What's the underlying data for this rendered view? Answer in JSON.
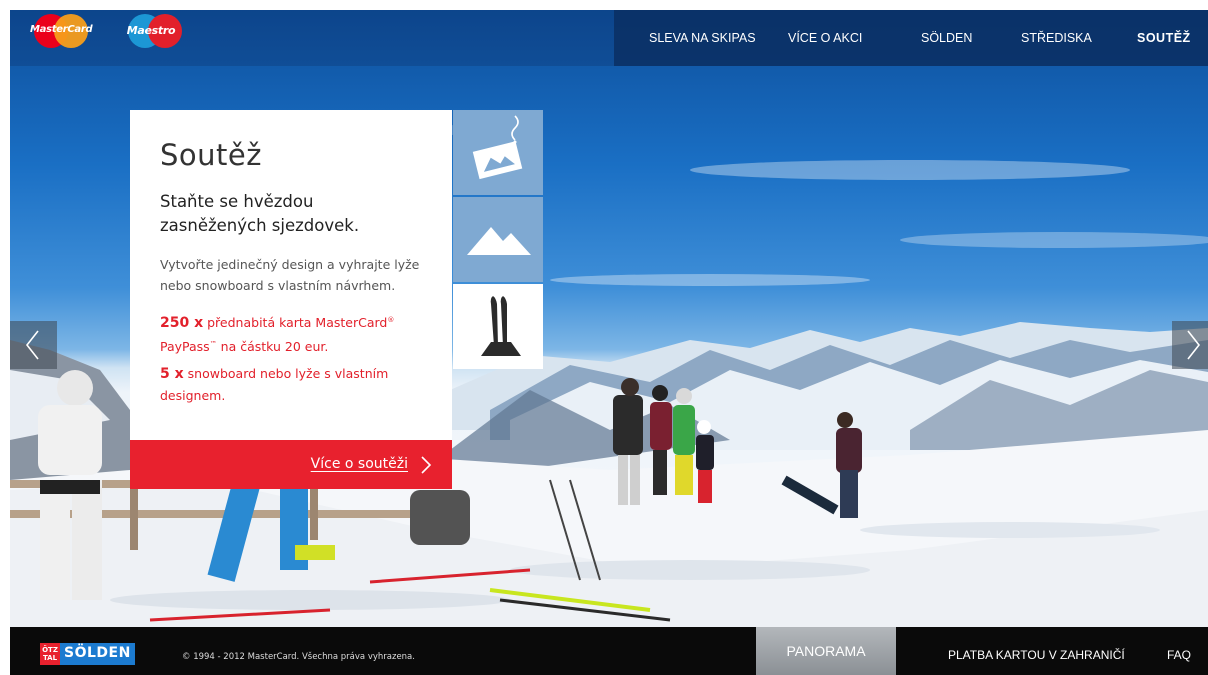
{
  "header": {
    "brand_logos": [
      {
        "name": "MasterCard",
        "text": "MasterCard",
        "colors": [
          "#eb001b",
          "#f79e1b"
        ]
      },
      {
        "name": "Maestro",
        "text": "Maestro",
        "colors": [
          "#1c97d5",
          "#e2202b"
        ]
      }
    ],
    "nav": [
      {
        "label": "SLEVA NA SKIPAS",
        "active": false
      },
      {
        "label": "VÍCE O AKCI",
        "active": false
      },
      {
        "label": "SÖLDEN",
        "active": false
      },
      {
        "label": "STŘEDISKA",
        "active": false
      },
      {
        "label": "SOUTĚŽ",
        "active": true
      }
    ]
  },
  "card": {
    "title": "Soutěž",
    "subtitle": "Staňte se hvězdou zasněžených sjezdovek.",
    "body": "Vytvořte jedinečný design a vyhrajte lyže nebo snowboard s vlastním návrhem.",
    "prize1_count": "250 x",
    "prize1_text_a": "přednabitá karta MasterCard",
    "prize1_sup": "®",
    "prize1_text_b": "PayPass",
    "prize1_tm": "™",
    "prize1_text_c": " na částku 20 eur.",
    "prize2_count": "5 x",
    "prize2_text": "snowboard nebo lyže s vlastním designem.",
    "cta_label": "Více o soutěži"
  },
  "tiles": [
    {
      "icon": "snow-postcard-icon"
    },
    {
      "icon": "mountain-icon"
    },
    {
      "icon": "skis-icon"
    }
  ],
  "footer": {
    "logo_tag": "ÖTZ TAL",
    "logo_word": "SÖLDEN",
    "copyright": "© 1994 - 2012 MasterCard. Všechna práva vyhrazena.",
    "panorama": "PANORAMA",
    "payment_link": "PLATBA KARTOU V ZAHRANIČÍ",
    "faq": "FAQ"
  },
  "colors": {
    "accent_red": "#e8212e",
    "tile_blue": "#7fa9d2",
    "nav_bg": "#0a2d5f"
  }
}
